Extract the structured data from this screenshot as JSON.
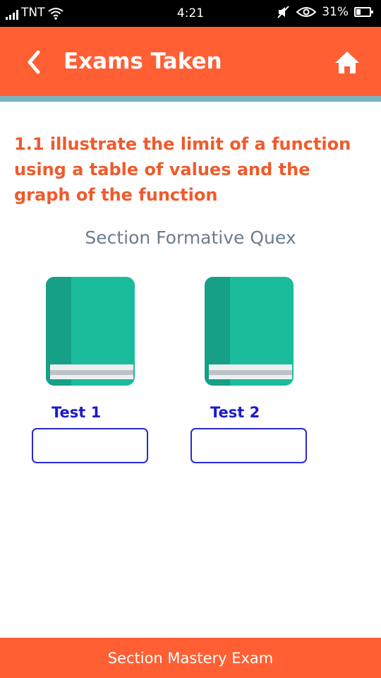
{
  "status_bar": {
    "carrier": "TNT",
    "time": "4:21",
    "battery": "31%",
    "icons": [
      "signal-icon",
      "wifi-icon",
      "mute-icon",
      "eye-icon",
      "battery-icon"
    ]
  },
  "header": {
    "title": "Exams Taken",
    "back_icon": "chevron-left-icon",
    "home_icon": "home-icon"
  },
  "lesson": {
    "title": "1.1 illustrate the limit of a function using a table of values and the graph of the function"
  },
  "section": {
    "heading": "Section Formative Quex"
  },
  "tests": [
    {
      "label": "Test  1",
      "score": ""
    },
    {
      "label": "Test  2",
      "score": ""
    }
  ],
  "footer": {
    "label": "Section Mastery Exam"
  },
  "colors": {
    "accent": "#ff5f33",
    "divider": "#79b5c1",
    "lesson_title": "#f05a2b",
    "section_heading": "#6b7c8f",
    "test_label": "#1a1acc",
    "book": "#1abc9c",
    "book_spine": "#16a085"
  }
}
